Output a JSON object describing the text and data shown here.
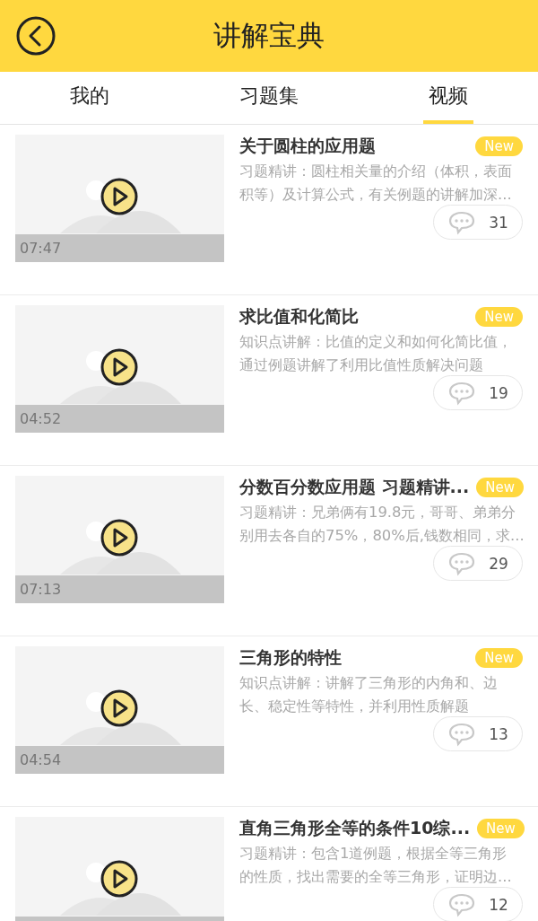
{
  "header": {
    "title": "讲解宝典"
  },
  "tabs": [
    {
      "label": "我的",
      "selected": false
    },
    {
      "label": "习题集",
      "selected": false
    },
    {
      "label": "视频",
      "selected": true
    }
  ],
  "videos": [
    {
      "title": "关于圆柱的应用题",
      "badge": "New",
      "description_lines": [
        "习题精讲：圆柱相关量的介绍（体积，表面",
        "积等）及计算公式，有关例题的讲解加深..."
      ],
      "duration": "07:47",
      "comments": "31"
    },
    {
      "title": "求比值和化简比",
      "badge": "New",
      "description_lines": [
        "知识点讲解：比值的定义和如何化简比值，",
        "通过例题讲解了利用比值性质解决问题"
      ],
      "duration": "04:52",
      "comments": "19"
    },
    {
      "title": "分数百分数应用题 习题精讲...",
      "badge": "New",
      "description_lines": [
        "习题精讲：兄弟俩有19.8元，哥哥、弟弟分",
        "别用去各自的75%，80%后,钱数相同，求..."
      ],
      "duration": "07:13",
      "comments": "29"
    },
    {
      "title": "三角形的特性",
      "badge": "New",
      "description_lines": [
        "知识点讲解：讲解了三角形的内角和、边",
        "长、稳定性等特性，并利用性质解题"
      ],
      "duration": "04:54",
      "comments": "13"
    },
    {
      "title": "直角三角形全等的条件10综...",
      "badge": "New",
      "description_lines": [
        "习题精讲：包含1道例题，根据全等三角形",
        "的性质，找出需要的全等三角形，证明边..."
      ],
      "comments": "12"
    }
  ]
}
